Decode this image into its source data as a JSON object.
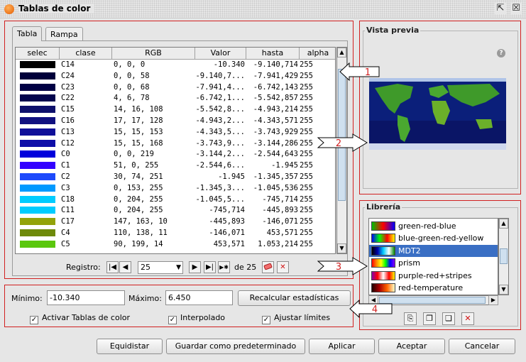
{
  "window": {
    "title": "Tablas de color"
  },
  "tabs": [
    {
      "label": "Tabla"
    },
    {
      "label": "Rampa"
    }
  ],
  "table": {
    "headers": [
      "selec",
      "clase",
      "RGB",
      "Valor",
      "hasta",
      "alpha"
    ],
    "rows": [
      {
        "color": "#000000",
        "clase": "C14",
        "rgb": "0, 0, 0",
        "valor": "-10.340",
        "hasta": "-9.140,714",
        "alpha": "255"
      },
      {
        "color": "#00003a",
        "clase": "C24",
        "rgb": "0, 0, 58",
        "valor": "-9.140,7...",
        "hasta": "-7.941,429",
        "alpha": "255"
      },
      {
        "color": "#000044",
        "clase": "C23",
        "rgb": "0, 0, 68",
        "valor": "-7.941,4...",
        "hasta": "-6.742,143",
        "alpha": "255"
      },
      {
        "color": "#04064e",
        "clase": "C22",
        "rgb": "4, 6, 78",
        "valor": "-6.742,1...",
        "hasta": "-5.542,857",
        "alpha": "255"
      },
      {
        "color": "#0e106c",
        "clase": "C15",
        "rgb": "14, 16, 108",
        "valor": "-5.542,8...",
        "hasta": "-4.943,214",
        "alpha": "255"
      },
      {
        "color": "#111180",
        "clase": "C16",
        "rgb": "17, 17, 128",
        "valor": "-4.943,2...",
        "hasta": "-4.343,571",
        "alpha": "255"
      },
      {
        "color": "#0f0f99",
        "clase": "C13",
        "rgb": "15, 15, 153",
        "valor": "-4.343,5...",
        "hasta": "-3.743,929",
        "alpha": "255"
      },
      {
        "color": "#0f0fa8",
        "clase": "C12",
        "rgb": "15, 15, 168",
        "valor": "-3.743,9...",
        "hasta": "-3.144,286",
        "alpha": "255"
      },
      {
        "color": "#0000db",
        "clase": "C0",
        "rgb": "0, 0, 219",
        "valor": "-3.144,2...",
        "hasta": "-2.544,643",
        "alpha": "255"
      },
      {
        "color": "#3300ff",
        "clase": "C1",
        "rgb": "51, 0, 255",
        "valor": "-2.544,6...",
        "hasta": "-1.945",
        "alpha": "255"
      },
      {
        "color": "#1e4afb",
        "clase": "C2",
        "rgb": "30, 74, 251",
        "valor": "-1.945",
        "hasta": "-1.345,357",
        "alpha": "255"
      },
      {
        "color": "#0099ff",
        "clase": "C3",
        "rgb": "0, 153, 255",
        "valor": "-1.345,3...",
        "hasta": "-1.045,536",
        "alpha": "255"
      },
      {
        "color": "#00ccff",
        "clase": "C18",
        "rgb": "0, 204, 255",
        "valor": "-1.045,5...",
        "hasta": "-745,714",
        "alpha": "255"
      },
      {
        "color": "#00ccff",
        "clase": "C11",
        "rgb": "0, 204, 255",
        "valor": "-745,714",
        "hasta": "-445,893",
        "alpha": "255"
      },
      {
        "color": "#93a30a",
        "clase": "C17",
        "rgb": "147, 163, 10",
        "valor": "-445,893",
        "hasta": "-146,071",
        "alpha": "255"
      },
      {
        "color": "#6e8a0b",
        "clase": "C4",
        "rgb": "110, 138, 11",
        "valor": "-146,071",
        "hasta": "453,571",
        "alpha": "255"
      },
      {
        "color": "#5ac70e",
        "clase": "C5",
        "rgb": "90, 199, 14",
        "valor": "453,571",
        "hasta": "1.053,214",
        "alpha": "255"
      }
    ]
  },
  "pagination": {
    "label": "Registro:",
    "current": "25",
    "of": "de 25"
  },
  "preview": {
    "legend": "Vista previa"
  },
  "library": {
    "legend": "Librería",
    "items": [
      {
        "label": "green-red-blue",
        "gradient": "linear-gradient(90deg,#00c000,#ff0000,#0000ff)"
      },
      {
        "label": "blue-green-red-yellow",
        "gradient": "linear-gradient(90deg,#0000ff,#00ff00,#ff0000,#ffff00)"
      },
      {
        "label": "MDT2",
        "gradient": "linear-gradient(90deg,#000000,#0000aa,#00ccff,#ffffff,#008800)"
      },
      {
        "label": "prism",
        "gradient": "linear-gradient(90deg,#ff0000,#ff8800,#ffff00,#00ff00,#0000ff,#8800ff)"
      },
      {
        "label": "purple-red+stripes",
        "gradient": "linear-gradient(90deg,#8800aa,#ff0000,#ffffff,#ff0000,#ffff00)"
      },
      {
        "label": "red-temperature",
        "gradient": "linear-gradient(90deg,#200000,#aa0000,#ff6600,#ffffcc)"
      }
    ],
    "selected_index": 2
  },
  "stats": {
    "min_label": "Mínimo:",
    "min_value": "-10.340",
    "max_label": "Máximo:",
    "max_value": "6.450",
    "recalc_label": "Recalcular estadísticas"
  },
  "checkboxes": {
    "activar": "Activar Tablas de color",
    "interpolado": "Interpolado",
    "ajustar": "Ajustar límites"
  },
  "buttons": {
    "equidistar": "Equidistar",
    "guardar": "Guardar como predeterminado",
    "aplicar": "Aplicar",
    "aceptar": "Aceptar",
    "cancelar": "Cancelar"
  },
  "callouts": [
    "1",
    "2",
    "3",
    "4"
  ],
  "colors": {
    "callout_red": "#d12020",
    "selection_blue": "#3a6fc4"
  }
}
